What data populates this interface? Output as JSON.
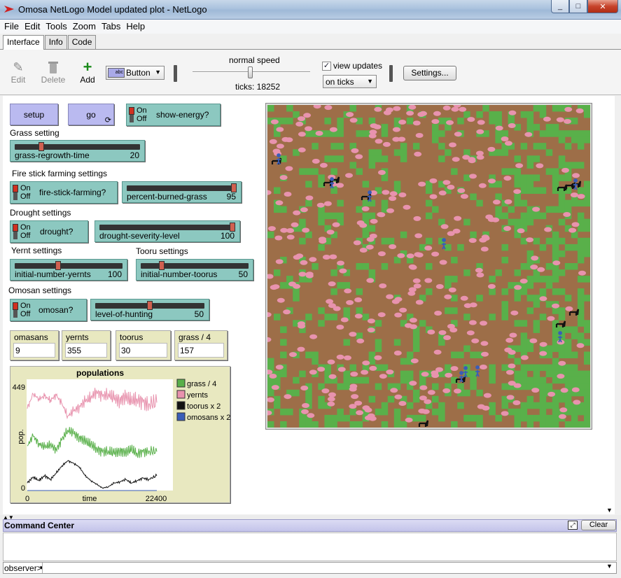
{
  "window": {
    "title": "Omosa NetLogo Model updated plot - NetLogo",
    "minimize_icon": "minimize-icon",
    "maximize_icon": "maximize-icon",
    "close_icon": "close-icon"
  },
  "menu": [
    "File",
    "Edit",
    "Tools",
    "Zoom",
    "Tabs",
    "Help"
  ],
  "tabs": [
    "Interface",
    "Info",
    "Code"
  ],
  "toolbar": {
    "edit_label": "Edit",
    "delete_label": "Delete",
    "add_label": "Add",
    "widget_type": "Button",
    "widget_icon_text": "abc",
    "speed_label": "normal speed",
    "speed_fraction": 0.5,
    "ticks_label": "ticks: 18252",
    "view_updates_label": "view updates",
    "view_updates_checked": true,
    "update_mode": "on ticks",
    "settings_label": "Settings..."
  },
  "buttons": {
    "setup": "setup",
    "go": "go",
    "go_icon": "forever-icon"
  },
  "switches": {
    "show_energy": {
      "on": "On",
      "off": "Off",
      "name": "show-energy?"
    },
    "fire_stick": {
      "on": "On",
      "off": "Off",
      "name": "fire-stick-farming?"
    },
    "drought": {
      "on": "On",
      "off": "Off",
      "name": "drought?"
    },
    "omosan": {
      "on": "On",
      "off": "Off",
      "name": "omosan?"
    }
  },
  "sections": {
    "grass": "Grass setting",
    "fire": "Fire stick farming settings",
    "drought": "Drought settings",
    "yernt": "Yernt settings",
    "tooru": "Tooru settings",
    "omosan": "Omosan settings"
  },
  "sliders": {
    "grass_regrowth": {
      "name": "grass-regrowth-time",
      "value": "20",
      "fraction": 0.2
    },
    "percent_burned": {
      "name": "percent-burned-grass",
      "value": "95",
      "fraction": 1.0
    },
    "drought_severity": {
      "name": "drought-severity-level",
      "value": "100",
      "fraction": 1.0
    },
    "initial_yernts": {
      "name": "initial-number-yernts",
      "value": "100",
      "fraction": 0.4
    },
    "initial_toorus": {
      "name": "initial-number-toorus",
      "value": "50",
      "fraction": 0.18
    },
    "level_hunting": {
      "name": "level-of-hunting",
      "value": "50",
      "fraction": 0.5
    }
  },
  "monitors": [
    {
      "name": "omasans",
      "value": "9"
    },
    {
      "name": "yernts",
      "value": "355"
    },
    {
      "name": "toorus",
      "value": "30"
    },
    {
      "name": "grass / 4",
      "value": "157"
    }
  ],
  "colors": {
    "grass": "#59b04a",
    "soil": "#9d6e48",
    "yernt": "#e893ae",
    "tooru": "#111111",
    "omosan": "#3a5db8",
    "button": "#babaf0",
    "widget": "#8cc8c0",
    "monitor": "#e8e8c0"
  },
  "chart_data": {
    "type": "line",
    "title": "populations",
    "xlabel": "time",
    "ylabel": "pop.",
    "xlim": [
      0,
      22400
    ],
    "ylim": [
      0,
      449
    ],
    "x_tick_labels": [
      "0",
      "22400"
    ],
    "y_tick_labels": [
      "0",
      "449"
    ],
    "legend_position": "right",
    "x": [
      0,
      1000,
      2000,
      3000,
      4000,
      5000,
      6000,
      7000,
      8000,
      9000,
      10000,
      11000,
      12000,
      13000,
      14000,
      15000,
      16000,
      17000,
      18000,
      19000,
      20000,
      21000,
      22400
    ],
    "series": [
      {
        "name": "grass / 4",
        "color": "#59b04a",
        "values": [
          180,
          220,
          190,
          175,
          185,
          165,
          205,
          245,
          230,
          215,
          200,
          185,
          170,
          155,
          160,
          150,
          160,
          155,
          165,
          150,
          155,
          160,
          157
        ]
      },
      {
        "name": "yernts",
        "color": "#e893ae",
        "values": [
          330,
          390,
          370,
          380,
          365,
          385,
          350,
          300,
          320,
          340,
          360,
          375,
          400,
          380,
          390,
          370,
          365,
          380,
          360,
          370,
          355,
          350,
          355
        ]
      },
      {
        "name": "toorus x 2",
        "color": "#111111",
        "values": [
          30,
          55,
          40,
          60,
          45,
          70,
          100,
          120,
          110,
          95,
          60,
          40,
          25,
          10,
          15,
          30,
          35,
          45,
          30,
          40,
          50,
          45,
          60
        ]
      },
      {
        "name": "omosans x 2",
        "color": "#3a5db8",
        "values": [
          0,
          0,
          0,
          0,
          0,
          0,
          0,
          0,
          0,
          0,
          0,
          0,
          0,
          0,
          0,
          0,
          0,
          0,
          0,
          0,
          0,
          0,
          0
        ]
      }
    ]
  },
  "command_center": {
    "title": "Command Center",
    "clear_label": "Clear",
    "expand_icon": "expand-icon",
    "prompt": "observer>",
    "input_value": ""
  }
}
